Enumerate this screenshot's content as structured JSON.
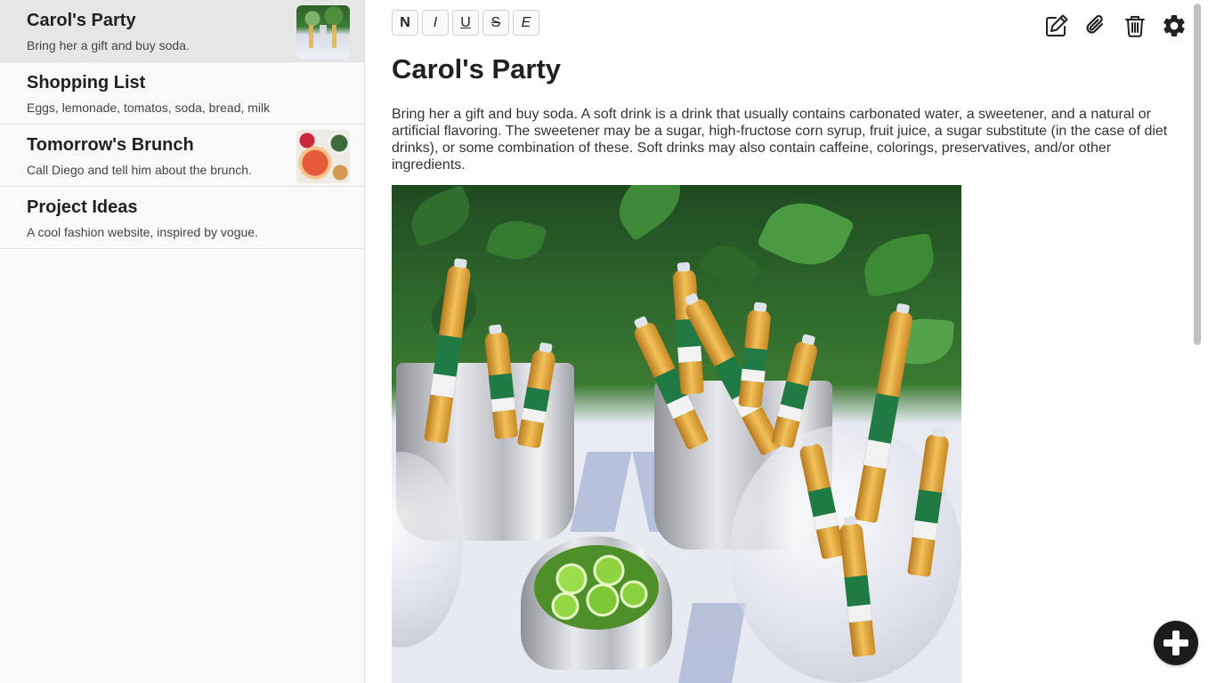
{
  "notes": [
    {
      "title": "Carol's Party",
      "preview": "Bring her a gift and buy soda.",
      "active": true,
      "has_thumbnail": true
    },
    {
      "title": "Shopping List",
      "preview": "Eggs, lemonade, tomatos, soda, bread, milk",
      "active": false,
      "has_thumbnail": false
    },
    {
      "title": "Tomorrow's Brunch",
      "preview": "Call Diego and tell him about the brunch.",
      "active": false,
      "has_thumbnail": true
    },
    {
      "title": "Project Ideas",
      "preview": "A cool fashion website, inspired by vogue.",
      "active": false,
      "has_thumbnail": false
    }
  ],
  "toolbar": {
    "bold": "N",
    "italic": "I",
    "underline": "U",
    "strike": "S",
    "emphasis": "E"
  },
  "actions": [
    "edit-icon",
    "attach-icon",
    "trash-icon",
    "settings-icon"
  ],
  "editor": {
    "title": "Carol's Party",
    "body": "Bring her a gift and buy soda. A soft drink is a drink that usually contains carbonated water, a sweetener, and a natural or artificial flavoring. The sweetener may be a sugar, high-fructose corn syrup, fruit juice, a sugar substitute (in the case of diet drinks), or some combination of these. Soft drinks may also contain caffeine, colorings, preservatives, and/or other ingredients.",
    "image": "party-drinks-photo"
  },
  "fab": {
    "icon": "plus-icon"
  },
  "colors": {
    "sidebar_bg": "#f9f9f9",
    "active_item_bg": "#e6e6e6",
    "fab_bg": "#1c1c1c",
    "text": "#212121"
  }
}
